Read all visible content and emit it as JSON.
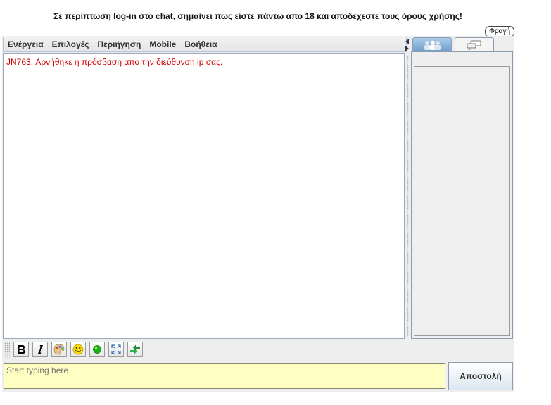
{
  "notice": "Σε περίπτωση log-in στο chat, σημαίνει πως είστε πάντω απο 18 και αποδέχεστε τους όρους χρήσης!",
  "block_button": "Φραγή",
  "menu": [
    "Ενέργεια",
    "Επιλογές",
    "Περιήγηση",
    "Mobile",
    "Βοήθεια"
  ],
  "chat": {
    "message": "JN763. Αρνήθηκε η πρόσβαση απο την διεύθυνση ip σας."
  },
  "tabs": [
    {
      "icon": "users-icon"
    },
    {
      "icon": "chat-bubbles-icon"
    }
  ],
  "toolbar": [
    {
      "icon": "bold-icon"
    },
    {
      "icon": "italic-icon"
    },
    {
      "icon": "color-palette-icon"
    },
    {
      "icon": "smiley-icon"
    },
    {
      "icon": "status-green-icon"
    },
    {
      "icon": "fullscreen-icon"
    },
    {
      "icon": "swap-arrows-icon"
    }
  ],
  "input": {
    "placeholder": "Start typing here"
  },
  "send_button": "Αποστολή",
  "colors": {
    "message": "#d40000",
    "input_bg": "#ffffc4",
    "status": "#1db318"
  }
}
